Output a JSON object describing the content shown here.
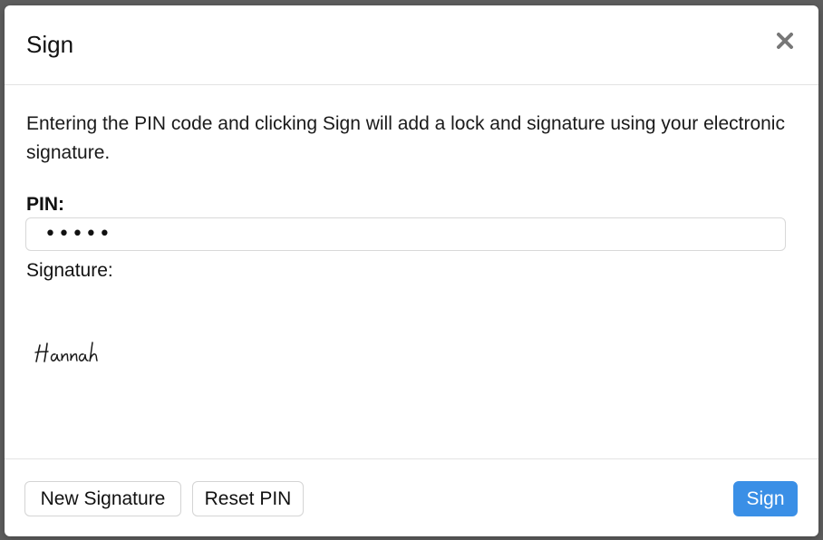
{
  "dialog": {
    "title": "Sign",
    "close_label": "×",
    "description": "Entering the PIN code and clicking Sign will add a lock and signature using your electronic signature.",
    "pin": {
      "label": "PIN:",
      "value": "•••••",
      "masked_length": 5
    },
    "signature": {
      "label": "Signature:",
      "drawn_name": "Hannah"
    },
    "footer": {
      "new_signature_label": "New Signature",
      "reset_pin_label": "Reset PIN",
      "sign_label": "Sign"
    }
  },
  "colors": {
    "primary": "#3a8fe6",
    "backdrop": "#5d5d5d",
    "close_icon": "#777777"
  },
  "icons": {
    "close": "close-icon"
  }
}
